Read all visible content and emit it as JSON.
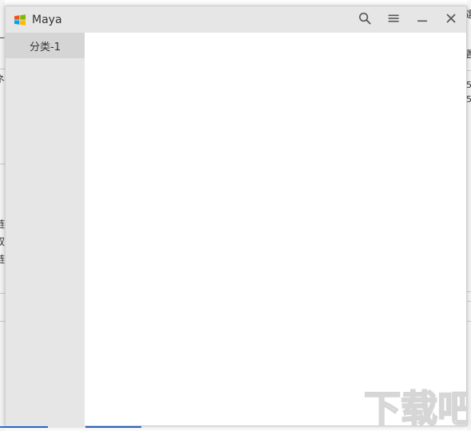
{
  "window": {
    "title": "Maya",
    "buttons": {
      "search": "search-icon",
      "menu": "hamburger-menu-icon",
      "minimize": "minimize-icon",
      "close": "close-icon"
    }
  },
  "sidebar": {
    "items": [
      {
        "label": "分类-1",
        "selected": true
      }
    ]
  },
  "background_fragments": {
    "left": [
      "ネ",
      "辶",
      "链",
      "双",
      "链"
    ],
    "right": [
      "選",
      "置",
      "5",
      "5"
    ]
  },
  "watermark": "下载吧",
  "colors": {
    "titlebar": "#e6e6e6",
    "sidebar": "#e6e6e6",
    "sidebar_selected": "#d5d5d5",
    "content": "#ffffff",
    "text": "#333333",
    "logo_red": "#f25022",
    "logo_green": "#7fba00",
    "logo_blue": "#00a4ef",
    "logo_yellow": "#ffb900"
  }
}
